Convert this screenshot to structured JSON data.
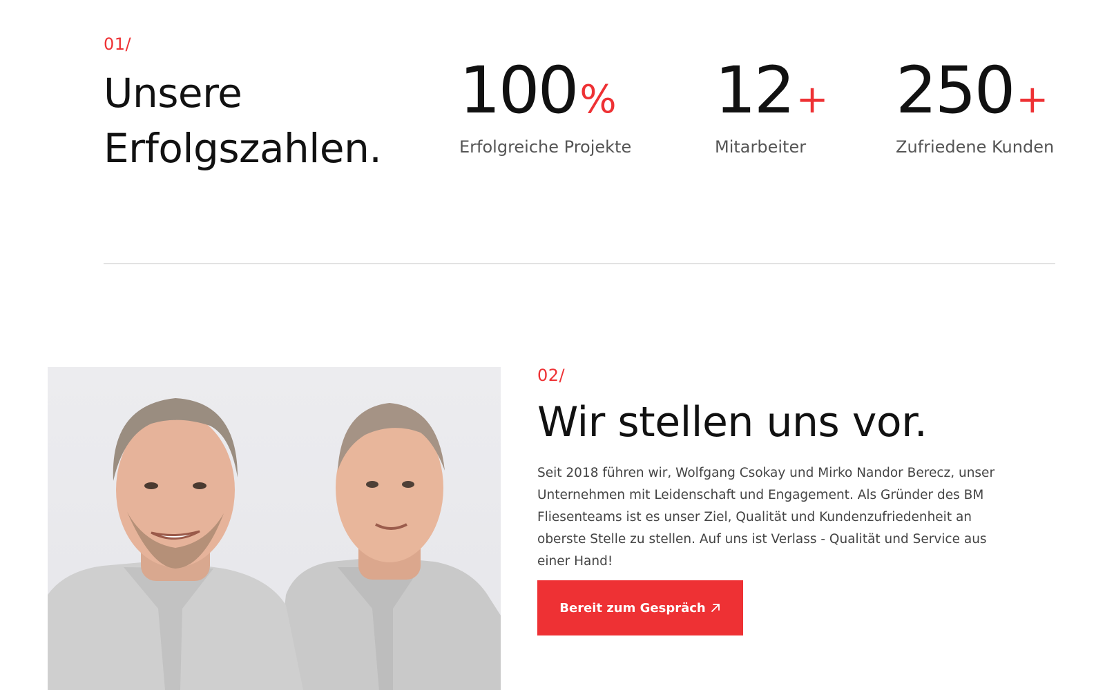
{
  "colors": {
    "accent": "#ee3134",
    "text": "#111111",
    "muted": "#555555",
    "divider": "#e2e2e2",
    "button_text": "#ffffff"
  },
  "stats_section": {
    "number": "01/",
    "heading_line1": "Unsere",
    "heading_line2": "Erfolgszahlen.",
    "stats": [
      {
        "value": "100",
        "suffix": "%",
        "label": "Erfolgreiche Projekte"
      },
      {
        "value": "12",
        "suffix": "+",
        "label": "Mitarbeiter"
      },
      {
        "value": "250",
        "suffix": "+",
        "label": "Zufriedene Kunden"
      }
    ]
  },
  "about_section": {
    "number": "02/",
    "heading": "Wir stellen uns vor.",
    "text": "Seit 2018 führen wir, Wolfgang Csokay und Mirko Nandor Berecz, unser Unternehmen mit Leidenschaft und Engagement. Als Gründer des BM Fliesenteams ist es unser Ziel, Qualität und Kundenzufriedenheit an oberste Stelle zu stellen. Auf uns ist Verlass - Qualität und Service aus einer Hand!",
    "button_label": "Bereit zum Gespräch",
    "button_icon": "arrow-up-right-icon",
    "photo_subject": "founders-photo"
  }
}
